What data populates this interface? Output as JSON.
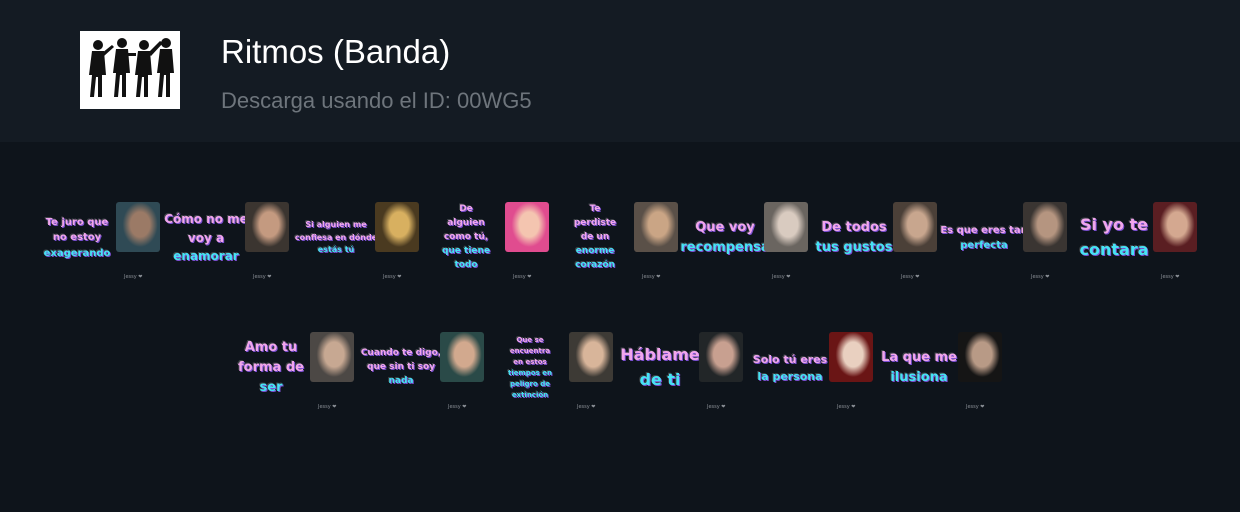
{
  "header": {
    "title": "Ritmos (Banda)",
    "subtitle": "Descarga usando el ID: 00WG5",
    "icon": "band-silhouette-icon"
  },
  "colors": {
    "caption_pink": "#f1a6ec",
    "caption_cyan": "#46e3f4",
    "background": "#0e141b",
    "header_bg": "#141b23"
  },
  "stickers": [
    {
      "lines": [
        "Te juro que",
        "no estoy",
        "exagerando"
      ],
      "signature": "Jessy ❤"
    },
    {
      "lines": [
        "Cómo no me",
        "voy a",
        "enamorar"
      ],
      "signature": "Jessy ❤"
    },
    {
      "lines": [
        "Si alguien me",
        "confiesa en dónde",
        "estás tú"
      ],
      "signature": "Jessy ❤"
    },
    {
      "lines": [
        "De",
        "alguien",
        "como tú,",
        "que tiene",
        "todo"
      ],
      "signature": "Jessy ❤"
    },
    {
      "lines": [
        "Te",
        "perdiste",
        "de un",
        "enorme",
        "corazón"
      ],
      "signature": "Jessy ❤"
    },
    {
      "lines": [
        "Que voy",
        "recompensa"
      ],
      "signature": "Jessy ❤"
    },
    {
      "lines": [
        "De todos",
        "tus gustos"
      ],
      "signature": "Jessy ❤"
    },
    {
      "lines": [
        "Es que eres tan",
        "perfecta"
      ],
      "signature": "Jessy ❤"
    },
    {
      "lines": [
        "Si yo te",
        "contara"
      ],
      "signature": "Jessy ❤"
    },
    {
      "lines": [
        "Amo tu",
        "forma de",
        "ser"
      ],
      "signature": "Jessy ❤"
    },
    {
      "lines": [
        "Cuando te digo,",
        "que sin ti soy",
        "nada"
      ],
      "signature": "Jessy ❤"
    },
    {
      "lines": [
        "Que se",
        "encuentra",
        "en estos",
        "tiempos en",
        "peligro de",
        "extinción"
      ],
      "signature": "Jessy ❤"
    },
    {
      "lines": [
        "Háblame",
        "de ti"
      ],
      "signature": "Jessy ❤"
    },
    {
      "lines": [
        "Solo tú eres",
        "la persona"
      ],
      "signature": "Jessy ❤"
    },
    {
      "lines": [
        "La que me",
        "ilusiona"
      ],
      "signature": "Jessy ❤"
    }
  ]
}
